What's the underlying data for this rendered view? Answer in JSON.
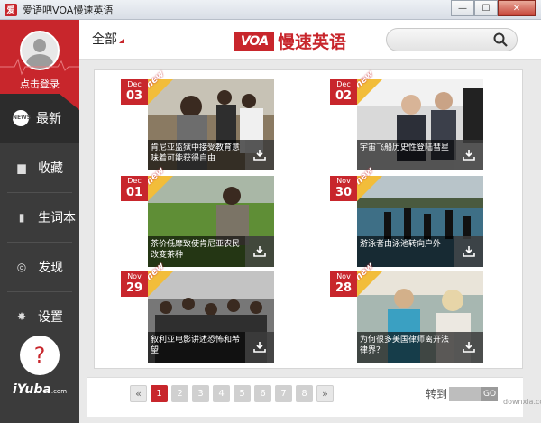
{
  "window": {
    "title": "爱语吧VOA慢速英语",
    "app_icon_glyph": "爱",
    "minimize_symbol": "—",
    "maximize_symbol": "☐",
    "close_symbol": "✕"
  },
  "sidebar": {
    "login_label": "点击登录",
    "items": [
      {
        "label": "最新",
        "icon": "news-icon",
        "glyph": "NEWS",
        "active": true
      },
      {
        "label": "收藏",
        "icon": "briefcase-icon",
        "glyph": "▆",
        "active": false
      },
      {
        "label": "生词本",
        "icon": "book-icon",
        "glyph": "▮",
        "active": false
      },
      {
        "label": "发现",
        "icon": "compass-icon",
        "glyph": "◎",
        "active": false
      },
      {
        "label": "设置",
        "icon": "gear-icon",
        "glyph": "✸",
        "active": false
      }
    ],
    "help_symbol": "?",
    "brand": "iYuba",
    "brand_suffix": ".com"
  },
  "header": {
    "category": "全部",
    "logo_mark": "VOA",
    "logo_text": "慢速英语",
    "search_placeholder": ""
  },
  "articles": [
    {
      "month": "Dec",
      "day": "03",
      "badge": "new",
      "title": "肯尼亚监狱中接受教育意味着可能获得自由",
      "scene": "prison"
    },
    {
      "month": "Dec",
      "day": "02",
      "badge": "new",
      "title": "宇宙飞船历史性登陆彗星",
      "scene": "space"
    },
    {
      "month": "Dec",
      "day": "01",
      "badge": "new",
      "title": "茶价低靡致使肯尼亚农民改变茶种",
      "scene": "tea"
    },
    {
      "month": "Nov",
      "day": "30",
      "badge": "new",
      "title": "游泳者由泳池转向户外",
      "scene": "swim"
    },
    {
      "month": "Nov",
      "day": "29",
      "badge": "new",
      "title": "叙利亚电影讲述恐怖和希望",
      "scene": "crowd"
    },
    {
      "month": "Nov",
      "day": "28",
      "badge": "new",
      "title": "为何很多美国律师离开法律界？",
      "scene": "women"
    }
  ],
  "pagination": {
    "prev": "«",
    "pages": [
      "1",
      "2",
      "3",
      "4",
      "5",
      "6",
      "7",
      "8"
    ],
    "current": "1",
    "next": "»",
    "goto_label": "转到",
    "goto_button": "GO",
    "watermark": "downxia.com"
  },
  "colors": {
    "brand_red": "#c8262c",
    "ribbon": "#f2bd3a",
    "sidebar": "#3b3b3b"
  }
}
